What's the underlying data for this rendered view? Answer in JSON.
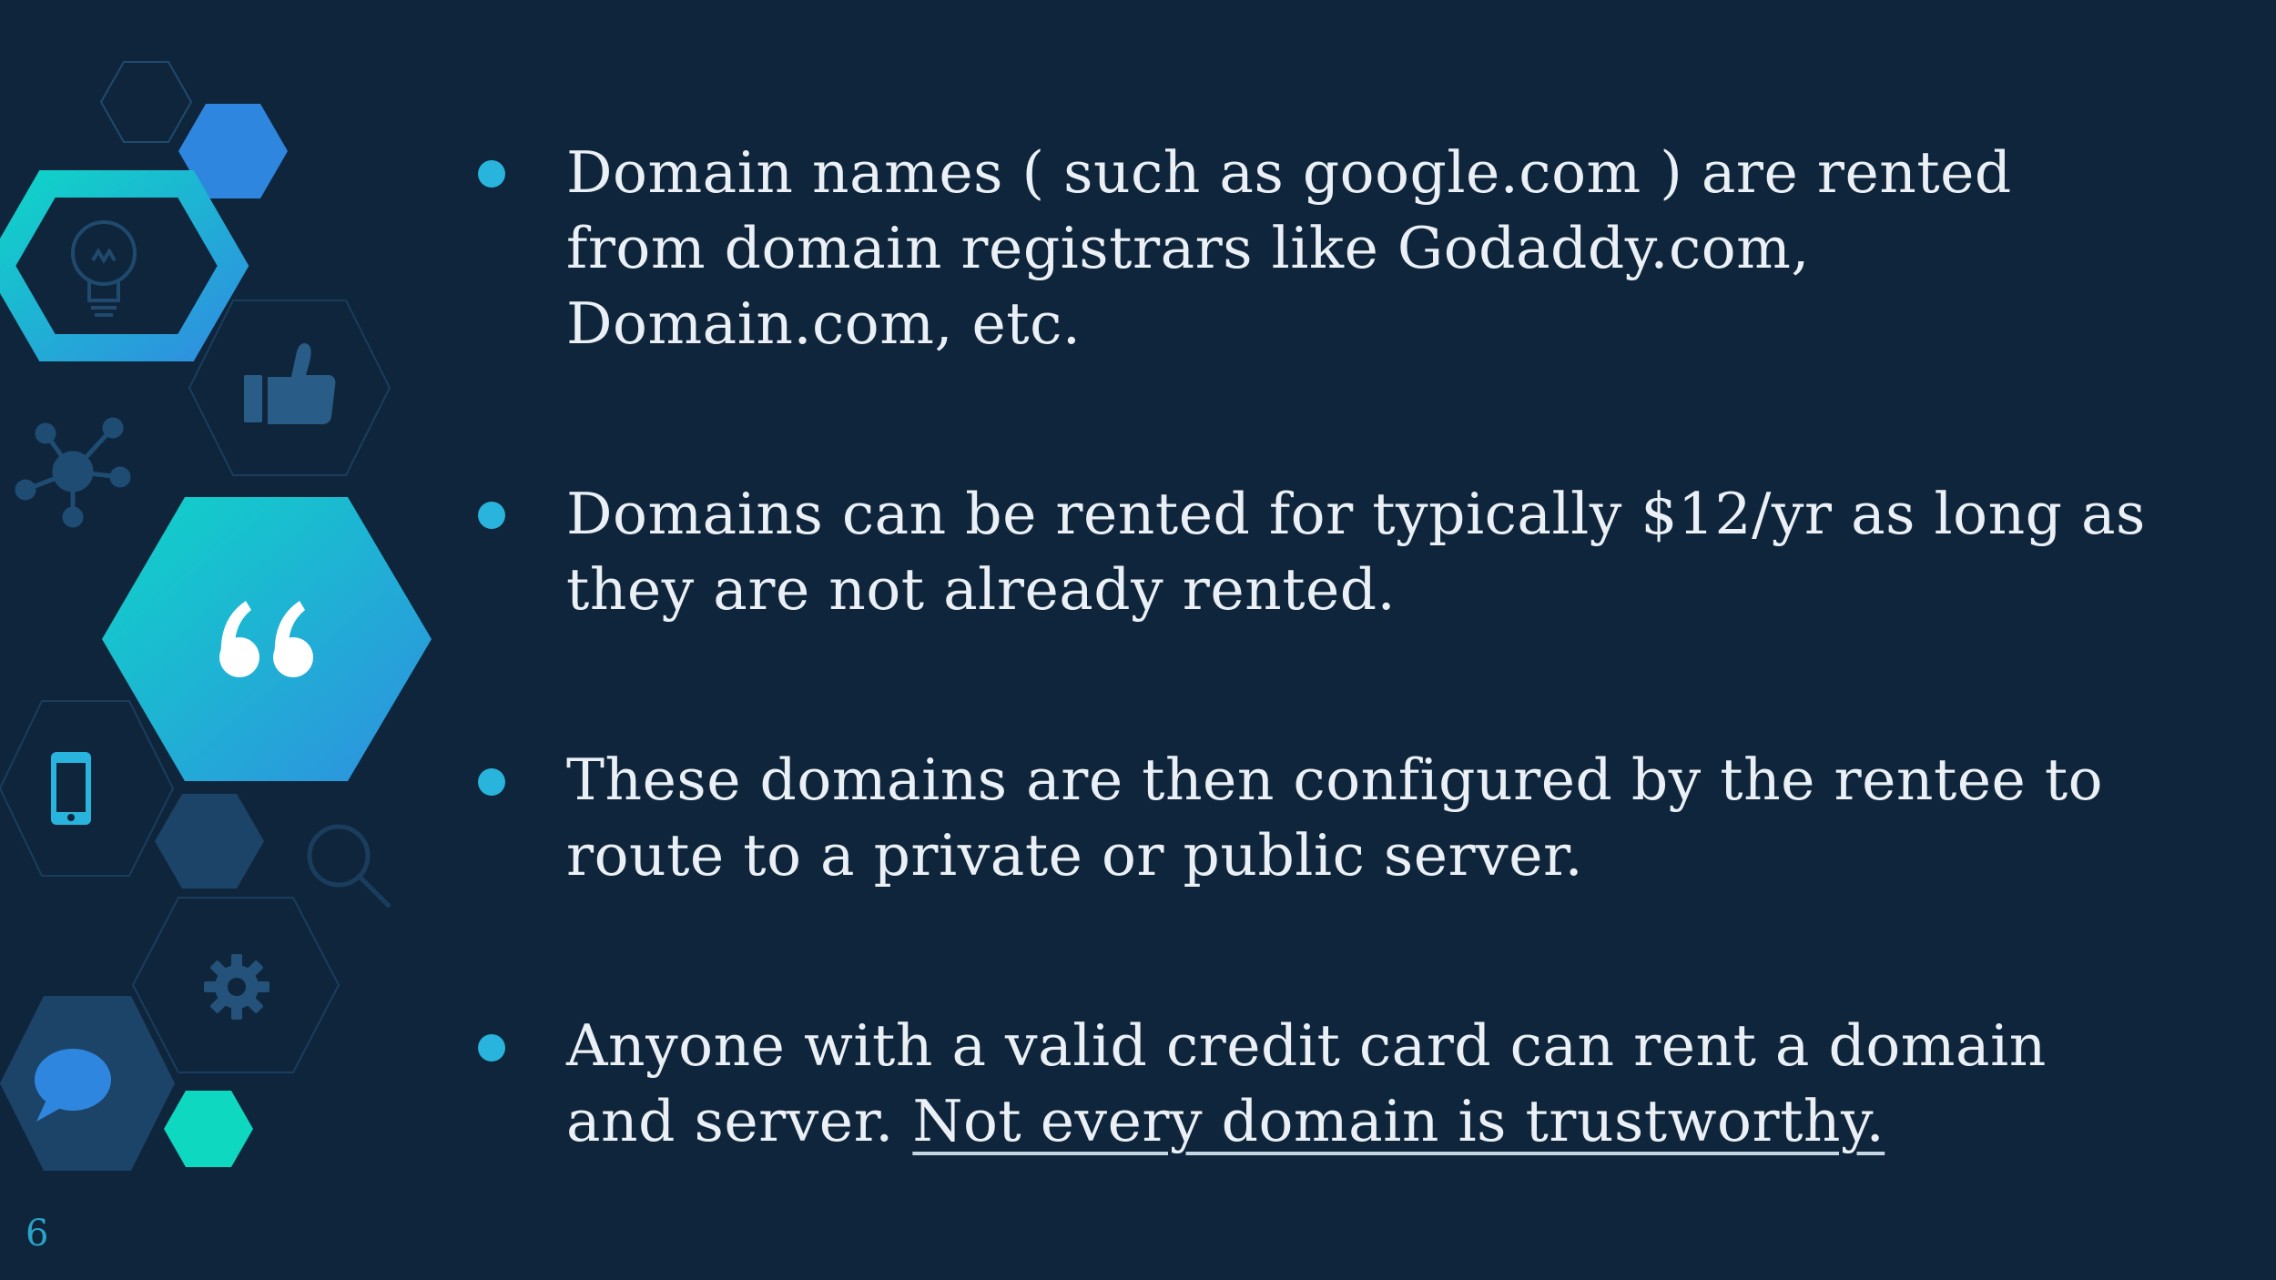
{
  "slide": {
    "page_number": "6",
    "bullets": [
      {
        "text": "Domain names ( such as google.com ) are rented\nfrom domain registrars like Godaddy.com,\nDomain.com, etc."
      },
      {
        "text": "Domains can be rented for typically $12/yr as long as\nthey are not already rented."
      },
      {
        "text": "These domains are then configured by the rentee to\nroute to a private or public server."
      },
      {
        "text": "Anyone with a valid credit card can rent a domain\nand server.  ",
        "emphasis": "Not every domain is trustworthy."
      }
    ]
  },
  "decoration": {
    "icons": [
      "lightbulb-icon",
      "thumbs-up-icon",
      "network-icon",
      "quote-icon",
      "smartphone-icon",
      "magnifier-icon",
      "gear-icon",
      "chat-bubble-icon"
    ],
    "colors": {
      "background": "#0f253b",
      "teal": "#0fd4c8",
      "blue": "#2e86de",
      "navy": "#1c4468",
      "bullet": "#28b4dc"
    }
  }
}
